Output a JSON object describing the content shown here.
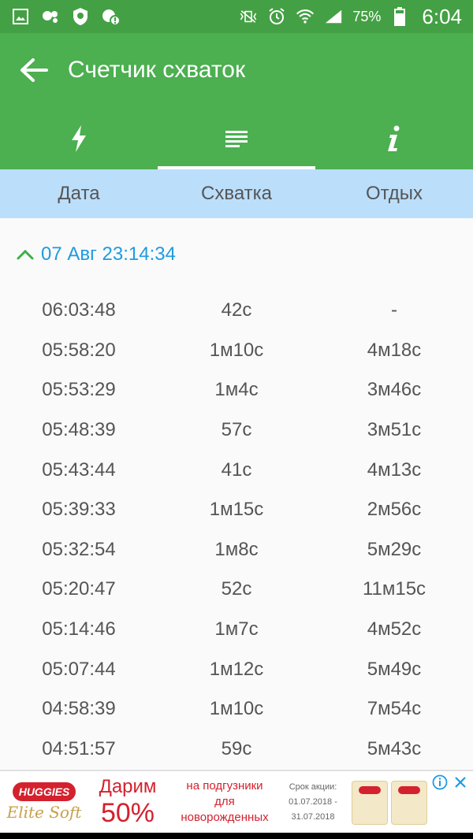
{
  "status_bar": {
    "battery": "75%",
    "time": "6:04"
  },
  "app_bar": {
    "title": "Счетчик схваток"
  },
  "tabs": [
    {
      "icon": "lightning-icon",
      "active": false
    },
    {
      "icon": "list-icon",
      "active": true
    },
    {
      "icon": "info-icon",
      "active": false
    }
  ],
  "columns": {
    "date": "Дата",
    "contraction": "Схватка",
    "rest": "Отдых"
  },
  "group": {
    "date": "07 Авг 23:14:34"
  },
  "rows": [
    {
      "time": "06:03:48",
      "contraction": "42с",
      "rest": "-"
    },
    {
      "time": "05:58:20",
      "contraction": "1м10с",
      "rest": "4м18с"
    },
    {
      "time": "05:53:29",
      "contraction": "1м4с",
      "rest": "3м46с"
    },
    {
      "time": "05:48:39",
      "contraction": "57с",
      "rest": "3м51с"
    },
    {
      "time": "05:43:44",
      "contraction": "41с",
      "rest": "4м13с"
    },
    {
      "time": "05:39:33",
      "contraction": "1м15с",
      "rest": "2м56с"
    },
    {
      "time": "05:32:54",
      "contraction": "1м8с",
      "rest": "5м29с"
    },
    {
      "time": "05:20:47",
      "contraction": "52с",
      "rest": "11м15с"
    },
    {
      "time": "05:14:46",
      "contraction": "1м7с",
      "rest": "4м52с"
    },
    {
      "time": "05:07:44",
      "contraction": "1м12с",
      "rest": "5м49с"
    },
    {
      "time": "04:58:39",
      "contraction": "1м10с",
      "rest": "7м54с"
    },
    {
      "time": "04:51:57",
      "contraction": "59с",
      "rest": "5м43с"
    }
  ],
  "ad": {
    "brand": "HUGGIES",
    "sub_brand": "Elite Soft",
    "offer_line1": "Дарим",
    "offer_line2": "50%",
    "text_line1": "на подгузники",
    "text_line2": "для",
    "text_line3": "новорожденных",
    "terms_line1": "Срок акции:",
    "terms_line2": "01.07.2018 -",
    "terms_line3": "31.07.2018"
  },
  "colors": {
    "primary": "#4caf50",
    "status_bar": "#44a044",
    "header_band": "#bbdefb",
    "accent_text": "#1e9be0"
  }
}
